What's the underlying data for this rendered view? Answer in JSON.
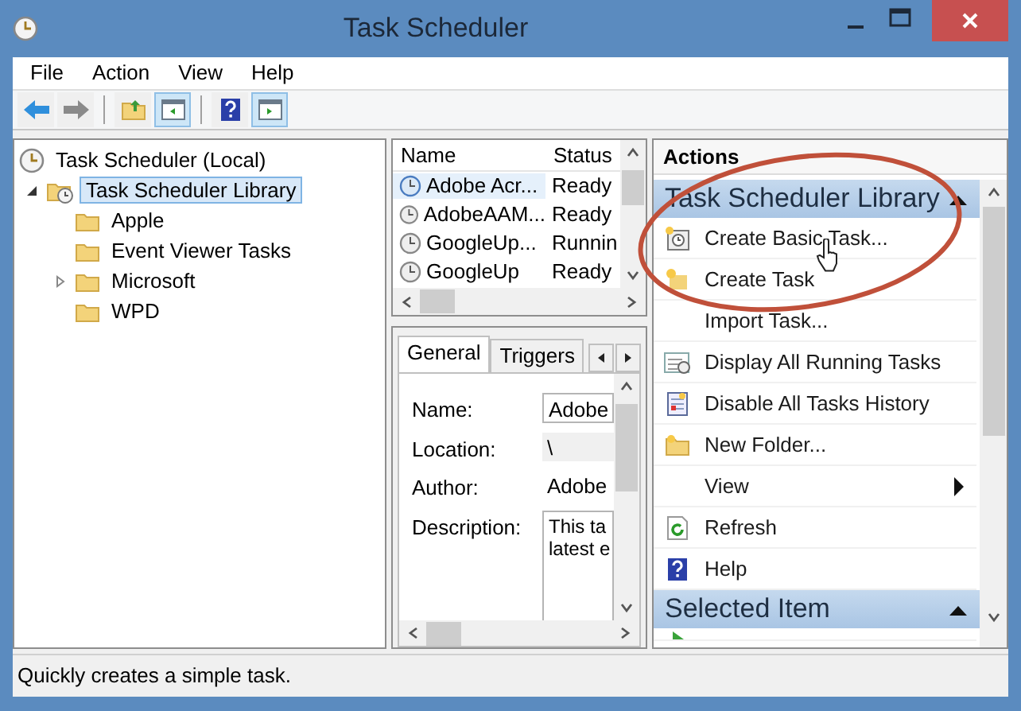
{
  "window": {
    "title": "Task Scheduler"
  },
  "menu": [
    "File",
    "Action",
    "View",
    "Help"
  ],
  "toolbar": [
    {
      "kind": "back"
    },
    {
      "kind": "forward",
      "disabled": true
    },
    {
      "kind": "separator"
    },
    {
      "kind": "up"
    },
    {
      "kind": "console-tree",
      "pressed": true
    },
    {
      "kind": "separator"
    },
    {
      "kind": "help"
    },
    {
      "kind": "action-pane",
      "pressed": true
    }
  ],
  "tree": {
    "label": "Task Scheduler (Local)",
    "kind": "computer",
    "selected": false,
    "children": [
      {
        "label": "Task Scheduler Library",
        "kind": "library",
        "selected": true,
        "expanded": true,
        "children": [
          {
            "label": "Apple",
            "kind": "folder",
            "selected": false
          },
          {
            "label": "Event Viewer Tasks",
            "kind": "folder",
            "selected": false
          },
          {
            "label": "Microsoft",
            "kind": "folder",
            "selected": false,
            "expanded": false
          },
          {
            "label": "WPD",
            "kind": "folder",
            "selected": false
          }
        ]
      }
    ]
  },
  "task_list": {
    "columns": [
      "Name",
      "Status"
    ],
    "rows": [
      {
        "name": "Adobe Acr...",
        "status": "Ready",
        "selected": true
      },
      {
        "name": "AdobeAAM...",
        "status": "Ready",
        "selected": false
      },
      {
        "name": "GoogleUp...",
        "status": "Runnin",
        "selected": false
      },
      {
        "name": "GoogleUp",
        "status": "Ready",
        "selected": false
      }
    ]
  },
  "details": {
    "tabs": [
      {
        "label": "General",
        "selected": true
      },
      {
        "label": "Triggers",
        "selected": false
      }
    ],
    "fields": [
      {
        "label": "Name:",
        "value": "Adobe",
        "kind": "textbox"
      },
      {
        "label": "Location:",
        "value": "\\",
        "kind": "readonly"
      },
      {
        "label": "Author:",
        "value": "Adobe",
        "kind": "text"
      },
      {
        "label": "Description:",
        "lines": [
          "This ta",
          "latest e"
        ],
        "kind": "textarea"
      }
    ]
  },
  "actions": {
    "header": "Actions",
    "sections": [
      {
        "title": "Task Scheduler Library",
        "expanded": true,
        "items": [
          {
            "label": "Create Basic Task...",
            "kind": "basic-task"
          },
          {
            "label": "Create Task",
            "kind": "task"
          },
          {
            "label": "Import Task...",
            "kind": "plain"
          },
          {
            "label": "Display All Running Tasks",
            "kind": "running"
          },
          {
            "label": "Disable All Tasks History",
            "kind": "history"
          },
          {
            "label": "New Folder...",
            "kind": "folder"
          },
          {
            "label": "View",
            "kind": "submenu"
          },
          {
            "label": "Refresh",
            "kind": "refresh"
          },
          {
            "label": "Help",
            "kind": "help"
          }
        ]
      },
      {
        "title": "Selected Item",
        "expanded": true,
        "items": [
          {
            "kind": "run"
          }
        ]
      }
    ]
  },
  "status_bar": "Quickly creates a simple task."
}
